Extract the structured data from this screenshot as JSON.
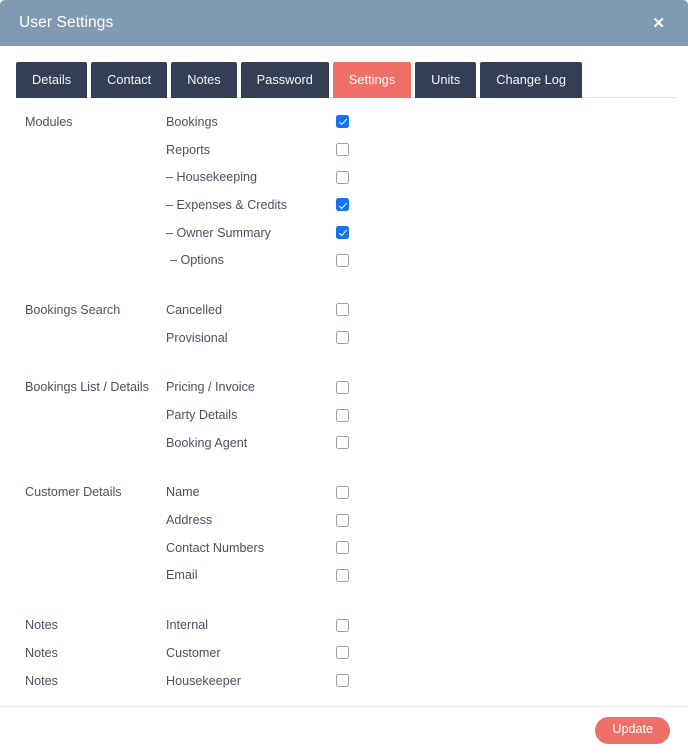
{
  "header": {
    "title": "User Settings",
    "close_label": "✕",
    "background_color": "#7f9ab1"
  },
  "tabs": {
    "active_index": 4,
    "items": [
      {
        "label": "Details"
      },
      {
        "label": "Contact"
      },
      {
        "label": "Notes"
      },
      {
        "label": "Password"
      },
      {
        "label": "Settings"
      },
      {
        "label": "Units"
      },
      {
        "label": "Change Log"
      }
    ],
    "active_color": "#ef7068",
    "inactive_color": "#343f56"
  },
  "settings": {
    "checkbox_checked_color": "#1572f0",
    "groups": [
      {
        "label": "Modules",
        "rows": [
          {
            "group_label": "Modules",
            "name": "Bookings",
            "checked": true,
            "indent": 0
          },
          {
            "group_label": "",
            "name": "Reports",
            "checked": false,
            "indent": 0
          },
          {
            "group_label": "",
            "name": "– Housekeeping",
            "checked": false,
            "indent": 1
          },
          {
            "group_label": "",
            "name": "– Expenses & Credits",
            "checked": true,
            "indent": 1
          },
          {
            "group_label": "",
            "name": "– Owner Summary",
            "checked": true,
            "indent": 1
          },
          {
            "group_label": "",
            "name": "– Options",
            "checked": false,
            "indent": 2
          }
        ]
      },
      {
        "label": "Bookings Search",
        "rows": [
          {
            "group_label": "Bookings Search",
            "name": "Cancelled",
            "checked": false,
            "indent": 0
          },
          {
            "group_label": "",
            "name": "Provisional",
            "checked": false,
            "indent": 0
          }
        ]
      },
      {
        "label": "Bookings List / Details",
        "rows": [
          {
            "group_label": "Bookings List / Details",
            "name": "Pricing / Invoice",
            "checked": false,
            "indent": 0
          },
          {
            "group_label": "",
            "name": "Party Details",
            "checked": false,
            "indent": 0
          },
          {
            "group_label": "",
            "name": "Booking Agent",
            "checked": false,
            "indent": 0
          }
        ]
      },
      {
        "label": "Customer Details",
        "rows": [
          {
            "group_label": "Customer Details",
            "name": "Name",
            "checked": false,
            "indent": 0
          },
          {
            "group_label": "",
            "name": "Address",
            "checked": false,
            "indent": 0
          },
          {
            "group_label": "",
            "name": "Contact Numbers",
            "checked": false,
            "indent": 0
          },
          {
            "group_label": "",
            "name": "Email",
            "checked": false,
            "indent": 0
          }
        ]
      },
      {
        "label": "Notes",
        "rows": [
          {
            "group_label": "Notes",
            "name": "Internal",
            "checked": false,
            "indent": 0
          },
          {
            "group_label": "Notes",
            "name": "Customer",
            "checked": false,
            "indent": 0
          },
          {
            "group_label": "Notes",
            "name": "Housekeeper",
            "checked": false,
            "indent": 0
          }
        ]
      }
    ]
  },
  "footer": {
    "update_label": "Update",
    "button_color": "#ef7068"
  }
}
